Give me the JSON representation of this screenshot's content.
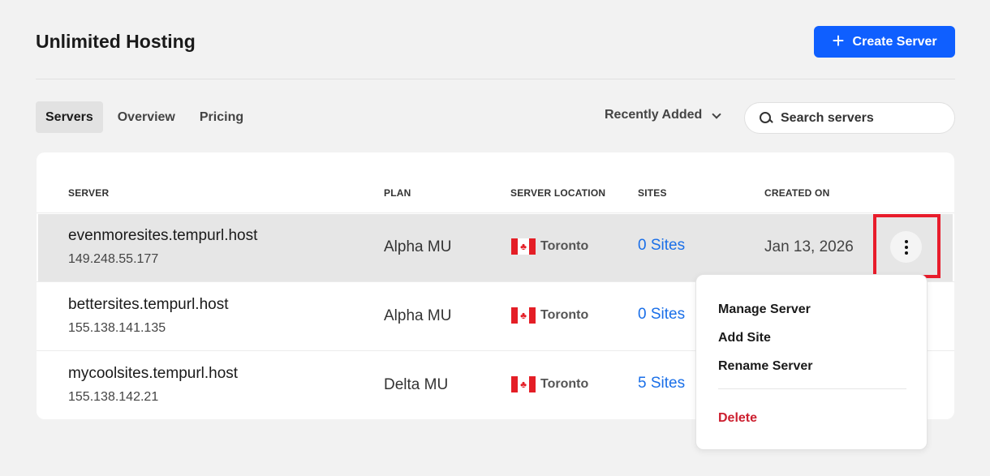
{
  "header": {
    "title": "Unlimited Hosting",
    "create_label": "Create Server",
    "create_icon": "plus-icon"
  },
  "tabs": [
    {
      "label": "Servers",
      "active": true
    },
    {
      "label": "Overview",
      "active": false
    },
    {
      "label": "Pricing",
      "active": false
    }
  ],
  "sort": {
    "label": "Recently Added"
  },
  "search": {
    "placeholder": "Search servers"
  },
  "table": {
    "columns": [
      "SERVER",
      "PLAN",
      "SERVER LOCATION",
      "SITES",
      "CREATED ON"
    ],
    "rows": [
      {
        "name": "evenmoresites.tempurl.host",
        "ip": "149.248.55.177",
        "plan": "Alpha MU",
        "location": "Toronto",
        "sites": "0 Sites",
        "created": "Jan 13, 2026"
      },
      {
        "name": "bettersites.tempurl.host",
        "ip": "155.138.141.135",
        "plan": "Alpha MU",
        "location": "Toronto",
        "sites": "0 Sites",
        "created": ""
      },
      {
        "name": "mycoolsites.tempurl.host",
        "ip": "155.138.142.21",
        "plan": "Delta MU",
        "location": "Toronto",
        "sites": "5 Sites",
        "created": ""
      }
    ]
  },
  "menu": {
    "items": [
      "Manage Server",
      "Add Site",
      "Rename Server"
    ],
    "delete": "Delete"
  },
  "colors": {
    "accent": "#0f5fff",
    "link": "#1a6fe8",
    "danger": "#cc1f2f",
    "highlight_box": "#e81c2b"
  }
}
